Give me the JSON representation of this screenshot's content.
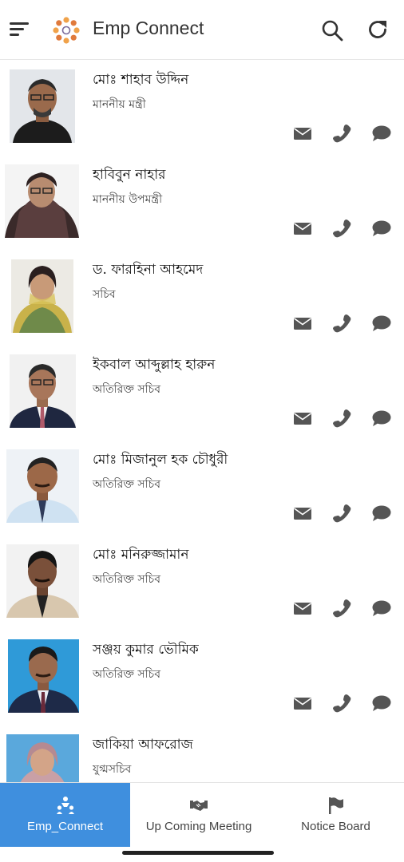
{
  "app_bar": {
    "title": "Emp Connect",
    "menu_icon": "hamburger-menu-icon",
    "logo_icon": "dots-circle-logo",
    "search_icon": "search-icon",
    "refresh_icon": "refresh-icon"
  },
  "employees": [
    {
      "name": "মোঃ শাহাব উদ্দিন",
      "designation": "মাননীয় মন্ত্রী"
    },
    {
      "name": "হাবিবুন নাহার",
      "designation": "মাননীয় উপমন্ত্রী"
    },
    {
      "name": "ড. ফারহিনা আহমেদ",
      "designation": "সচিব"
    },
    {
      "name": "ইকবাল আব্দুল্লাহ হারুন",
      "designation": "অতিরিক্ত সচিব"
    },
    {
      "name": "মোঃ মিজানুল হক চৌধুরী",
      "designation": "অতিরিক্ত সচিব"
    },
    {
      "name": "মোঃ মনিরুজ্জামান",
      "designation": "অতিরিক্ত সচিব"
    },
    {
      "name": "সঞ্জয় কুমার ভৌমিক",
      "designation": "অতিরিক্ত সচিব"
    },
    {
      "name": "জাকিয়া আফরোজ",
      "designation": "যুগ্মসচিব"
    }
  ],
  "row_actions": [
    "mail-icon",
    "phone-icon",
    "chat-icon"
  ],
  "bottom_nav": {
    "items": [
      {
        "label": "Emp_Connect",
        "icon": "people-icon",
        "active": true
      },
      {
        "label": "Up Coming Meeting",
        "icon": "handshake-icon",
        "active": false
      },
      {
        "label": "Notice Board",
        "icon": "flag-icon",
        "active": false
      }
    ]
  },
  "colors": {
    "accent": "#3f8fde",
    "icon_gray": "#555555",
    "divider": "#e8e8e8"
  }
}
